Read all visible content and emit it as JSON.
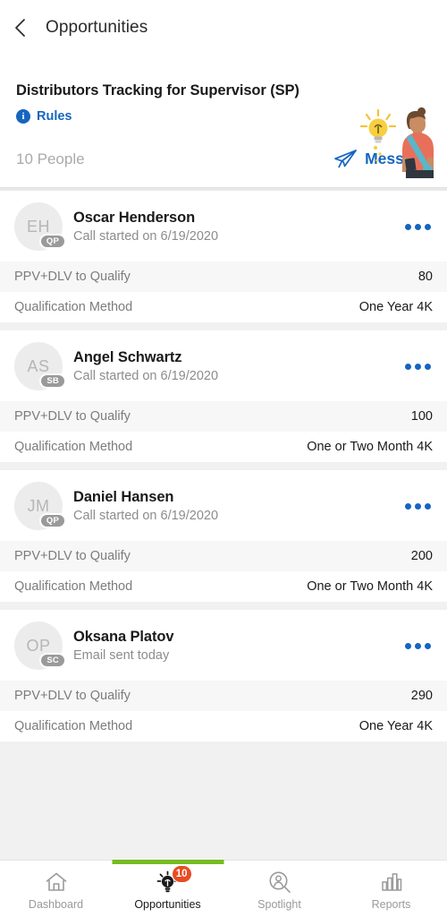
{
  "nav": {
    "back_icon": "chevron-left-icon",
    "title": "Opportunities"
  },
  "header": {
    "title": "Distributors Tracking for Supervisor (SP)",
    "info_icon_label": "i",
    "rules_label": "Rules",
    "people_count": "10 People",
    "message_label": "Message",
    "message_icon": "paper-plane-icon",
    "illustration": "person-with-idea-lightbulb-illustration",
    "accent_blue": "#1565c0",
    "muted_gray": "#aaaaaa"
  },
  "people": [
    {
      "initials": "EH",
      "badge": "QP",
      "name": "Oscar Henderson",
      "status": "Call started on 6/19/2020",
      "details": [
        {
          "key": "PPV+DLV to Qualify",
          "value": "80"
        },
        {
          "key": "Qualification Method",
          "value": "One Year 4K"
        }
      ]
    },
    {
      "initials": "AS",
      "badge": "SB",
      "name": "Angel Schwartz",
      "status": "Call started on 6/19/2020",
      "details": [
        {
          "key": "PPV+DLV to Qualify",
          "value": "100"
        },
        {
          "key": "Qualification Method",
          "value": "One or Two Month 4K"
        }
      ]
    },
    {
      "initials": "JM",
      "badge": "QP",
      "name": "Daniel Hansen",
      "status": "Call started on 6/19/2020",
      "details": [
        {
          "key": "PPV+DLV to Qualify",
          "value": "200"
        },
        {
          "key": "Qualification Method",
          "value": "One or Two Month 4K"
        }
      ]
    },
    {
      "initials": "OP",
      "badge": "SC",
      "name": "Oksana Platov",
      "status": "Email sent today",
      "details": [
        {
          "key": "PPV+DLV to Qualify",
          "value": "290"
        },
        {
          "key": "Qualification Method",
          "value": "One Year 4K"
        }
      ]
    }
  ],
  "row_actions": {
    "more_icon": "more-horizontal-icon"
  },
  "tabbar": {
    "active_indicator_color": "#76bc21",
    "badge_color": "#e84c22",
    "tabs": [
      {
        "label": "Dashboard",
        "icon": "home-icon",
        "active": false,
        "badge": ""
      },
      {
        "label": "Opportunities",
        "icon": "lightbulb-icon",
        "active": true,
        "badge": "10"
      },
      {
        "label": "Spotlight",
        "icon": "person-search-icon",
        "active": false,
        "badge": ""
      },
      {
        "label": "Reports",
        "icon": "bar-chart-icon",
        "active": false,
        "badge": ""
      }
    ]
  }
}
